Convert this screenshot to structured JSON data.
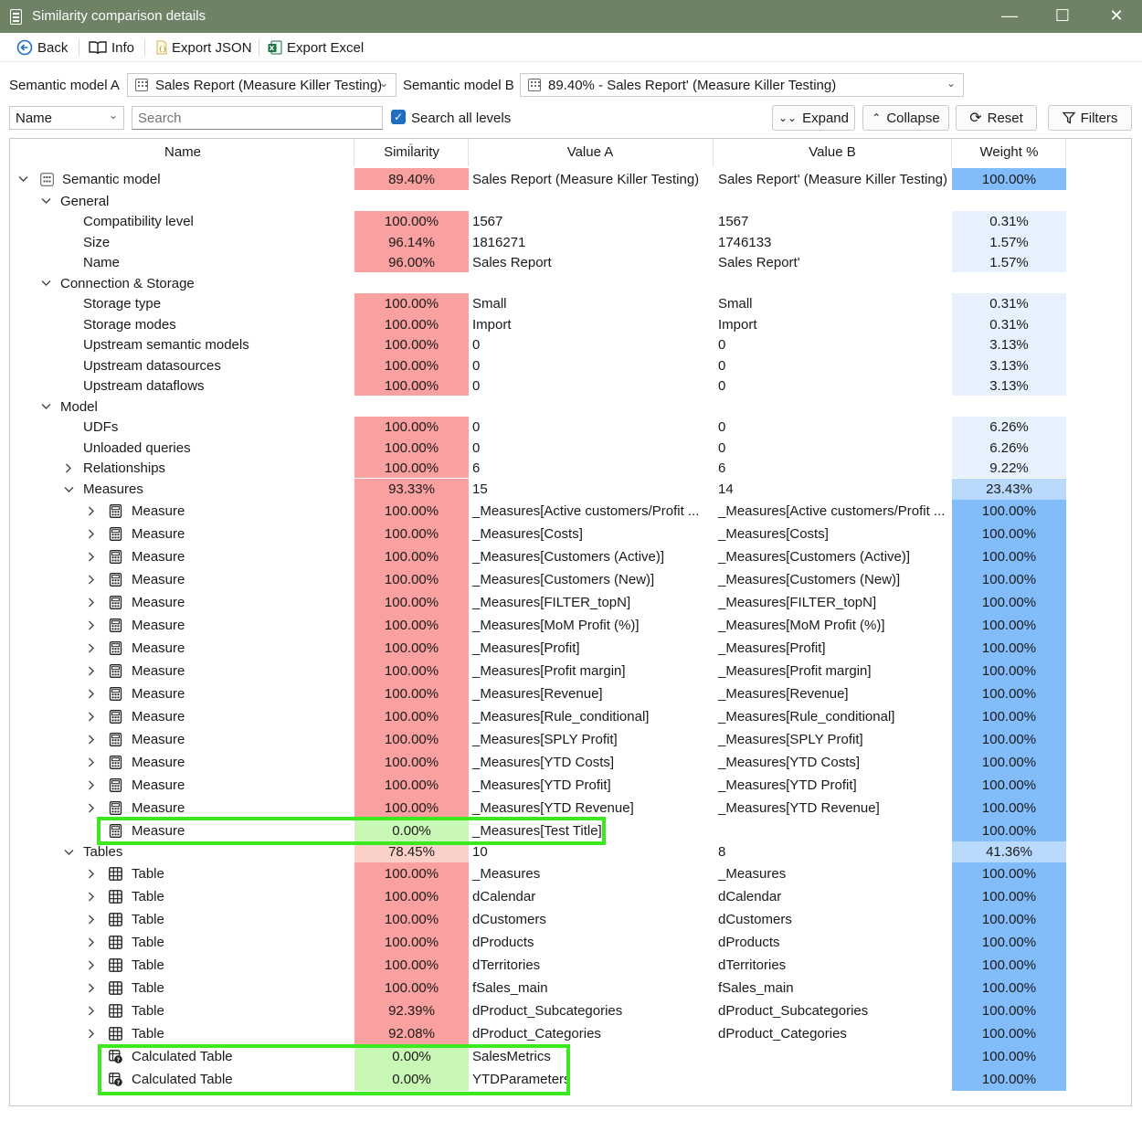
{
  "window": {
    "title": "Similarity comparison details",
    "minimize": "—",
    "maximize": "☐",
    "close": "✕"
  },
  "toolbar": {
    "back": "Back",
    "info": "Info",
    "export_json": "Export JSON",
    "export_excel": "Export Excel"
  },
  "models": {
    "label_a": "Semantic model A",
    "value_a": "Sales Report (Measure Killer Testing)",
    "label_b": "Semantic model B",
    "value_b": "89.40% - Sales Report' (Measure Killer Testing)"
  },
  "filters": {
    "field": "Name",
    "search_placeholder": "Search",
    "search_all_levels": "Search all levels",
    "expand": "Expand",
    "collapse": "Collapse",
    "reset": "Reset",
    "filters": "Filters"
  },
  "columns": {
    "name": "Name",
    "similarity": "Similarity",
    "value_a": "Value A",
    "value_b": "Value B",
    "weight": "Weight %"
  },
  "colors": {
    "sim_red": "#f9a0a0",
    "sim_green": "#c9f7b6",
    "sim_light": "#fad0c8",
    "weight_strong": "#82bcfa",
    "weight_mid": "#b9dafc",
    "weight_light": "#e6f1fd",
    "highlight": "#3ce81e",
    "titlebar": "#6e8265"
  },
  "rows": [
    {
      "level": 0,
      "exp": "down",
      "icon": "model-icon",
      "name": "Semantic model",
      "sim": "89.40%",
      "a": "Sales Report (Measure Killer Testing)",
      "b": "Sales Report' (Measure Killer Testing)",
      "w": "100.00%",
      "simc": "red",
      "wc": "strong"
    },
    {
      "level": 1,
      "exp": "down",
      "icon": "",
      "name": "General",
      "sim": "",
      "a": "",
      "b": "",
      "w": "",
      "simc": "",
      "wc": ""
    },
    {
      "level": 2,
      "exp": "",
      "icon": "",
      "name": "Compatibility level",
      "sim": "100.00%",
      "a": "1567",
      "b": "1567",
      "w": "0.31%",
      "simc": "red",
      "wc": "light"
    },
    {
      "level": 2,
      "exp": "",
      "icon": "",
      "name": "Size",
      "sim": "96.14%",
      "a": "1816271",
      "b": "1746133",
      "w": "1.57%",
      "simc": "red",
      "wc": "light"
    },
    {
      "level": 2,
      "exp": "",
      "icon": "",
      "name": "Name",
      "sim": "96.00%",
      "a": "Sales Report",
      "b": "Sales Report'",
      "w": "1.57%",
      "simc": "red",
      "wc": "light"
    },
    {
      "level": 1,
      "exp": "down",
      "icon": "",
      "name": "Connection & Storage",
      "sim": "",
      "a": "",
      "b": "",
      "w": "",
      "simc": "",
      "wc": ""
    },
    {
      "level": 2,
      "exp": "",
      "icon": "",
      "name": "Storage type",
      "sim": "100.00%",
      "a": "Small",
      "b": "Small",
      "w": "0.31%",
      "simc": "red",
      "wc": "light"
    },
    {
      "level": 2,
      "exp": "",
      "icon": "",
      "name": "Storage modes",
      "sim": "100.00%",
      "a": "Import",
      "b": "Import",
      "w": "0.31%",
      "simc": "red",
      "wc": "light"
    },
    {
      "level": 2,
      "exp": "",
      "icon": "",
      "name": "Upstream semantic models",
      "sim": "100.00%",
      "a": "0",
      "b": "0",
      "w": "3.13%",
      "simc": "red",
      "wc": "light"
    },
    {
      "level": 2,
      "exp": "",
      "icon": "",
      "name": "Upstream datasources",
      "sim": "100.00%",
      "a": "0",
      "b": "0",
      "w": "3.13%",
      "simc": "red",
      "wc": "light"
    },
    {
      "level": 2,
      "exp": "",
      "icon": "",
      "name": "Upstream dataflows",
      "sim": "100.00%",
      "a": "0",
      "b": "0",
      "w": "3.13%",
      "simc": "red",
      "wc": "light"
    },
    {
      "level": 1,
      "exp": "down",
      "icon": "",
      "name": "Model",
      "sim": "",
      "a": "",
      "b": "",
      "w": "",
      "simc": "",
      "wc": ""
    },
    {
      "level": 2,
      "exp": "",
      "icon": "",
      "name": "UDFs",
      "sim": "100.00%",
      "a": "0",
      "b": "0",
      "w": "6.26%",
      "simc": "red",
      "wc": "light"
    },
    {
      "level": 2,
      "exp": "",
      "icon": "",
      "name": "Unloaded queries",
      "sim": "100.00%",
      "a": "0",
      "b": "0",
      "w": "6.26%",
      "simc": "red",
      "wc": "light"
    },
    {
      "level": 2,
      "exp": "right",
      "icon": "",
      "name": "Relationships",
      "sim": "100.00%",
      "a": "6",
      "b": "6",
      "w": "9.22%",
      "simc": "red",
      "wc": "light"
    },
    {
      "level": 2,
      "exp": "down",
      "icon": "",
      "name": "Measures",
      "sim": "93.33%",
      "a": "15",
      "b": "14",
      "w": "23.43%",
      "simc": "red",
      "wc": "mid"
    },
    {
      "level": 3,
      "exp": "right",
      "icon": "measure-icon",
      "name": "Measure",
      "sim": "100.00%",
      "a": "_Measures[Active customers/Profit ...",
      "b": "_Measures[Active customers/Profit ...",
      "w": "100.00%",
      "simc": "red",
      "wc": "strong"
    },
    {
      "level": 3,
      "exp": "right",
      "icon": "measure-icon",
      "name": "Measure",
      "sim": "100.00%",
      "a": "_Measures[Costs]",
      "b": "_Measures[Costs]",
      "w": "100.00%",
      "simc": "red",
      "wc": "strong"
    },
    {
      "level": 3,
      "exp": "right",
      "icon": "measure-icon",
      "name": "Measure",
      "sim": "100.00%",
      "a": "_Measures[Customers (Active)]",
      "b": "_Measures[Customers (Active)]",
      "w": "100.00%",
      "simc": "red",
      "wc": "strong"
    },
    {
      "level": 3,
      "exp": "right",
      "icon": "measure-icon",
      "name": "Measure",
      "sim": "100.00%",
      "a": "_Measures[Customers (New)]",
      "b": "_Measures[Customers (New)]",
      "w": "100.00%",
      "simc": "red",
      "wc": "strong"
    },
    {
      "level": 3,
      "exp": "right",
      "icon": "measure-icon",
      "name": "Measure",
      "sim": "100.00%",
      "a": "_Measures[FILTER_topN]",
      "b": "_Measures[FILTER_topN]",
      "w": "100.00%",
      "simc": "red",
      "wc": "strong"
    },
    {
      "level": 3,
      "exp": "right",
      "icon": "measure-icon",
      "name": "Measure",
      "sim": "100.00%",
      "a": "_Measures[MoM Profit (%)]",
      "b": "_Measures[MoM Profit (%)]",
      "w": "100.00%",
      "simc": "red",
      "wc": "strong"
    },
    {
      "level": 3,
      "exp": "right",
      "icon": "measure-icon",
      "name": "Measure",
      "sim": "100.00%",
      "a": "_Measures[Profit]",
      "b": "_Measures[Profit]",
      "w": "100.00%",
      "simc": "red",
      "wc": "strong"
    },
    {
      "level": 3,
      "exp": "right",
      "icon": "measure-icon",
      "name": "Measure",
      "sim": "100.00%",
      "a": "_Measures[Profit margin]",
      "b": "_Measures[Profit margin]",
      "w": "100.00%",
      "simc": "red",
      "wc": "strong"
    },
    {
      "level": 3,
      "exp": "right",
      "icon": "measure-icon",
      "name": "Measure",
      "sim": "100.00%",
      "a": "_Measures[Revenue]",
      "b": "_Measures[Revenue]",
      "w": "100.00%",
      "simc": "red",
      "wc": "strong"
    },
    {
      "level": 3,
      "exp": "right",
      "icon": "measure-icon",
      "name": "Measure",
      "sim": "100.00%",
      "a": "_Measures[Rule_conditional]",
      "b": "_Measures[Rule_conditional]",
      "w": "100.00%",
      "simc": "red",
      "wc": "strong"
    },
    {
      "level": 3,
      "exp": "right",
      "icon": "measure-icon",
      "name": "Measure",
      "sim": "100.00%",
      "a": "_Measures[SPLY Profit]",
      "b": "_Measures[SPLY Profit]",
      "w": "100.00%",
      "simc": "red",
      "wc": "strong"
    },
    {
      "level": 3,
      "exp": "right",
      "icon": "measure-icon",
      "name": "Measure",
      "sim": "100.00%",
      "a": "_Measures[YTD Costs]",
      "b": "_Measures[YTD Costs]",
      "w": "100.00%",
      "simc": "red",
      "wc": "strong"
    },
    {
      "level": 3,
      "exp": "right",
      "icon": "measure-icon",
      "name": "Measure",
      "sim": "100.00%",
      "a": "_Measures[YTD Profit]",
      "b": "_Measures[YTD Profit]",
      "w": "100.00%",
      "simc": "red",
      "wc": "strong"
    },
    {
      "level": 3,
      "exp": "right",
      "icon": "measure-icon",
      "name": "Measure",
      "sim": "100.00%",
      "a": "_Measures[YTD Revenue]",
      "b": "_Measures[YTD Revenue]",
      "w": "100.00%",
      "simc": "red",
      "wc": "strong"
    },
    {
      "level": 3,
      "exp": "",
      "icon": "measure-icon",
      "name": "Measure",
      "sim": "0.00%",
      "a": "_Measures[Test Title]",
      "b": "",
      "w": "100.00%",
      "simc": "green",
      "wc": "strong"
    },
    {
      "level": 2,
      "exp": "down",
      "icon": "",
      "name": "Tables",
      "sim": "78.45%",
      "a": "10",
      "b": "8",
      "w": "41.36%",
      "simc": "light",
      "wc": "mid"
    },
    {
      "level": 3,
      "exp": "right",
      "icon": "table-icon",
      "name": "Table",
      "sim": "100.00%",
      "a": "_Measures",
      "b": "_Measures",
      "w": "100.00%",
      "simc": "red",
      "wc": "strong"
    },
    {
      "level": 3,
      "exp": "right",
      "icon": "table-icon",
      "name": "Table",
      "sim": "100.00%",
      "a": "dCalendar",
      "b": "dCalendar",
      "w": "100.00%",
      "simc": "red",
      "wc": "strong"
    },
    {
      "level": 3,
      "exp": "right",
      "icon": "table-icon",
      "name": "Table",
      "sim": "100.00%",
      "a": "dCustomers",
      "b": "dCustomers",
      "w": "100.00%",
      "simc": "red",
      "wc": "strong"
    },
    {
      "level": 3,
      "exp": "right",
      "icon": "table-icon",
      "name": "Table",
      "sim": "100.00%",
      "a": "dProducts",
      "b": "dProducts",
      "w": "100.00%",
      "simc": "red",
      "wc": "strong"
    },
    {
      "level": 3,
      "exp": "right",
      "icon": "table-icon",
      "name": "Table",
      "sim": "100.00%",
      "a": "dTerritories",
      "b": "dTerritories",
      "w": "100.00%",
      "simc": "red",
      "wc": "strong"
    },
    {
      "level": 3,
      "exp": "right",
      "icon": "table-icon",
      "name": "Table",
      "sim": "100.00%",
      "a": "fSales_main",
      "b": "fSales_main",
      "w": "100.00%",
      "simc": "red",
      "wc": "strong"
    },
    {
      "level": 3,
      "exp": "right",
      "icon": "table-icon",
      "name": "Table",
      "sim": "92.39%",
      "a": "dProduct_Subcategories",
      "b": "dProduct_Subcategories",
      "w": "100.00%",
      "simc": "red",
      "wc": "strong"
    },
    {
      "level": 3,
      "exp": "right",
      "icon": "table-icon",
      "name": "Table",
      "sim": "92.08%",
      "a": "dProduct_Categories",
      "b": "dProduct_Categories",
      "w": "100.00%",
      "simc": "red",
      "wc": "strong"
    },
    {
      "level": 3,
      "exp": "",
      "icon": "calculated-table-icon",
      "name": "Calculated Table",
      "sim": "0.00%",
      "a": "SalesMetrics",
      "b": "",
      "w": "100.00%",
      "simc": "green",
      "wc": "strong"
    },
    {
      "level": 3,
      "exp": "",
      "icon": "calculated-table-icon",
      "name": "Calculated Table",
      "sim": "0.00%",
      "a": "YTDParameters",
      "b": "",
      "w": "100.00%",
      "simc": "green",
      "wc": "strong"
    }
  ]
}
